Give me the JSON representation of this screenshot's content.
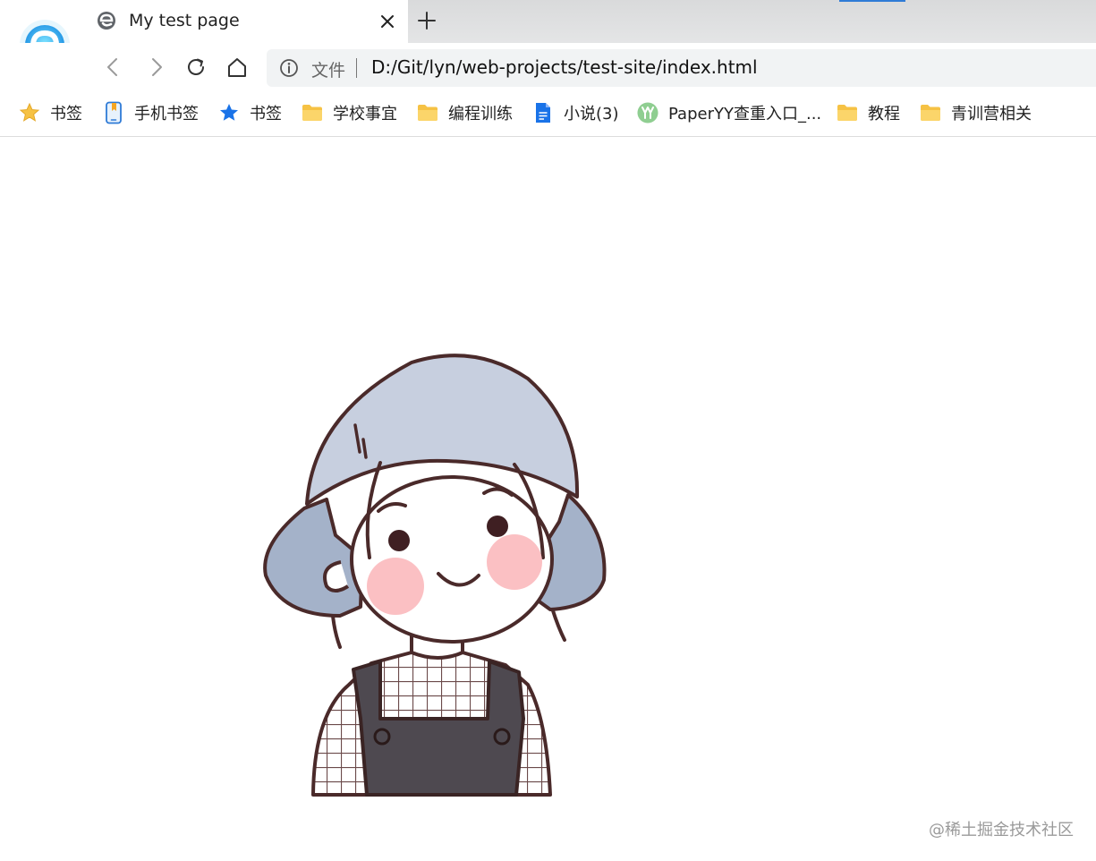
{
  "browser": {
    "tab": {
      "title": "My test page"
    },
    "address": {
      "scheme_label": "文件",
      "url": "D:/Git/lyn/web-projects/test-site/index.html"
    },
    "bookmarks": [
      {
        "label": "书签",
        "icon": "star-icon"
      },
      {
        "label": "手机书签",
        "icon": "phone-bookmark-icon"
      },
      {
        "label": "书签",
        "icon": "blue-star-icon"
      },
      {
        "label": "学校事宜",
        "icon": "folder-icon"
      },
      {
        "label": "编程训练",
        "icon": "folder-icon"
      },
      {
        "label": "小说(3)",
        "icon": "document-icon"
      },
      {
        "label": "PaperYY查重入口_...",
        "icon": "paperyy-icon"
      },
      {
        "label": "教程",
        "icon": "folder-icon"
      },
      {
        "label": "青训营相关",
        "icon": "folder-icon"
      }
    ],
    "colors": {
      "accent": "#2f7bd6",
      "folder": "#f6c244",
      "titlebar": "#dedfe0",
      "address_bg": "#f1f3f4"
    }
  },
  "page": {
    "image": "cartoon-girl-bucket-hat",
    "watermark": "@稀土掘金技术社区"
  }
}
